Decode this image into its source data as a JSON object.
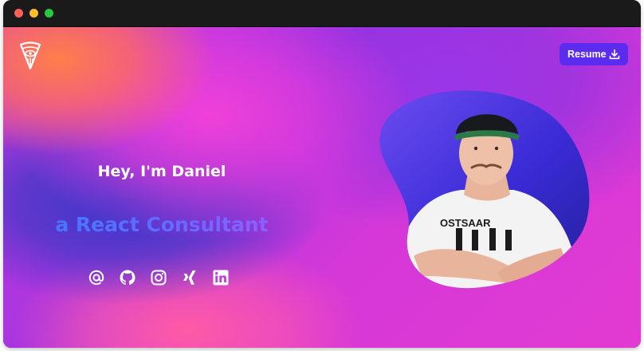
{
  "header": {
    "resume_label": "Resume"
  },
  "hero": {
    "greeting": "Hey, I'm Daniel",
    "tagline": "a React Consultant",
    "shirt_text": "OSTSAAR"
  },
  "social_links": [
    {
      "icon": "at-sign-icon"
    },
    {
      "icon": "github-icon"
    },
    {
      "icon": "instagram-icon"
    },
    {
      "icon": "xing-icon"
    },
    {
      "icon": "linkedin-icon"
    }
  ],
  "colors": {
    "resume_button": "#5b2bf0",
    "tagline_gradient_start": "#3d7cff",
    "tagline_gradient_end": "#a05bff",
    "blob": "#3a2bd6"
  }
}
